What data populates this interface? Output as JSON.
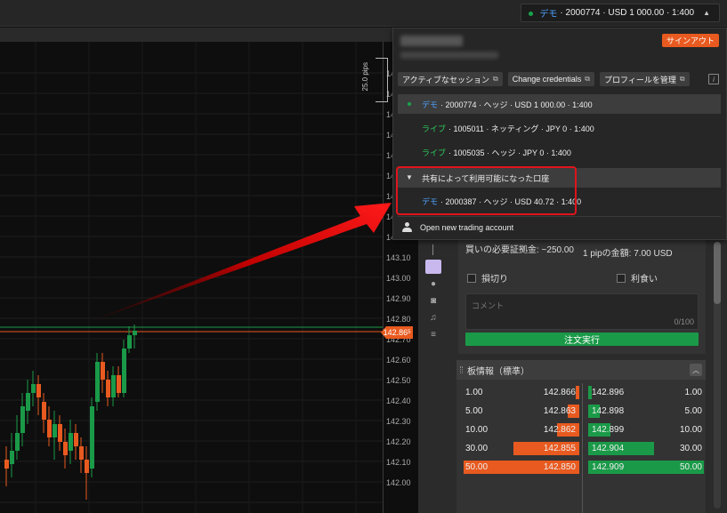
{
  "topbar": {
    "account_demo_tag": "デモ",
    "account_summary": "· 2000774 · USD 1 000.00 · 1:400",
    "caret": "▲"
  },
  "chart": {
    "pips_label": "25.0 pips",
    "price_ticks": [
      "14",
      "14",
      "14",
      "14",
      "14",
      "14",
      "14",
      "14",
      "143.20",
      "143.10",
      "143.00",
      "142.90",
      "142.80",
      "142.70",
      "142.60",
      "142.50",
      "142.40",
      "142.30",
      "142.20",
      "142.10",
      "142.00"
    ],
    "current_price_tag": "142.86",
    "current_price_tag_suffix": "5",
    "colors": {
      "up": "#1a9a48",
      "down": "#e85a1f",
      "bid_line": "#e85a1f",
      "ask_line": "#1a9a48"
    }
  },
  "account_menu": {
    "signout_label": "サインアウト",
    "links": [
      {
        "label": "アクティブなセッション",
        "icon": "external-link-icon"
      },
      {
        "label": "Change credentials",
        "icon": "external-link-icon"
      },
      {
        "label": "プロフィールを管理",
        "icon": "external-link-icon"
      }
    ],
    "info_icon": "i",
    "accounts": [
      {
        "type": "デモ",
        "detail": "· 2000774 · ヘッジ · USD 1 000.00 · 1:400",
        "current": true
      },
      {
        "type": "ライブ",
        "detail": "· 1005011 · ネッティング · JPY 0 · 1:400",
        "current": false
      },
      {
        "type": "ライブ",
        "detail": "· 1005035 · ヘッジ · JPY 0 · 1:400",
        "current": false
      }
    ],
    "shared_header": "共有によって利用可能になった口座",
    "shared_account": {
      "type": "デモ",
      "detail": "· 2000387 · ヘッジ · USD 40.72 · 1:400"
    },
    "open_new_label": "Open new trading account"
  },
  "order_panel": {
    "margin_text": "買いの必要証拠金: ~250.00",
    "pip_value_text": "1 pipの金額: 7.00 USD",
    "stop_loss_label": "損切り",
    "take_profit_label": "利食い",
    "comment_placeholder": "コメント",
    "comment_counter": "0/100",
    "execute_label": "注文実行"
  },
  "order_book": {
    "title": "板情報（標準）",
    "bids": [
      {
        "volume": "1.00",
        "price": "142.866",
        "fill": 0.02
      },
      {
        "volume": "5.00",
        "price": "142.863",
        "fill": 0.1
      },
      {
        "volume": "10.00",
        "price": "142.862",
        "fill": 0.19
      },
      {
        "volume": "30.00",
        "price": "142.855",
        "fill": 0.57
      },
      {
        "volume": "50.00",
        "price": "142.850",
        "fill": 1.0
      }
    ],
    "asks": [
      {
        "price": "142.896",
        "volume": "1.00",
        "fill": 0.02
      },
      {
        "price": "142.898",
        "volume": "5.00",
        "fill": 0.1
      },
      {
        "price": "142.899",
        "volume": "10.00",
        "fill": 0.19
      },
      {
        "price": "142.904",
        "volume": "30.00",
        "fill": 0.57
      },
      {
        "price": "142.909",
        "volume": "50.00",
        "fill": 1.0
      }
    ]
  }
}
